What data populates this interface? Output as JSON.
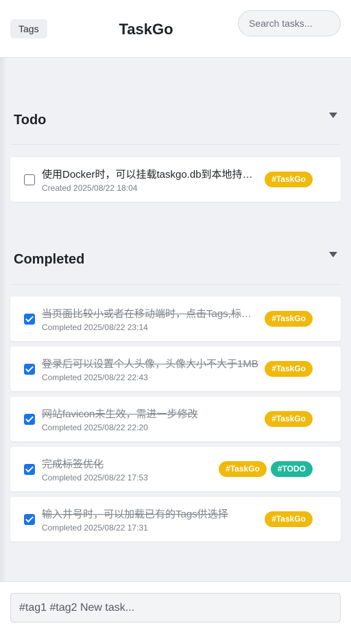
{
  "header": {
    "tags_label": "Tags",
    "title": "TaskGo",
    "search_placeholder": "Search tasks..."
  },
  "sections": {
    "todo": {
      "title": "Todo"
    },
    "completed": {
      "title": "Completed"
    }
  },
  "todo_tasks": [
    {
      "text": "使用Docker时，可以挂载taskgo.db到本地持久化数据",
      "meta": "Created 2025/08/22 18:04",
      "checked": false,
      "tags": [
        {
          "label": "#TaskGo",
          "color": "#f0b90b"
        }
      ]
    }
  ],
  "completed_tasks": [
    {
      "text": "当页面比较小或者在移动端时，点击Tags,标签栏显示",
      "meta": "Completed 2025/08/22 23:14",
      "checked": true,
      "tags": [
        {
          "label": "#TaskGo",
          "color": "#f0b90b"
        }
      ]
    },
    {
      "text": "登录后可以设置个人头像，头像大小不大于1MB",
      "meta": "Completed 2025/08/22 22:43",
      "checked": true,
      "tags": [
        {
          "label": "#TaskGo",
          "color": "#f0b90b"
        }
      ]
    },
    {
      "text": "网站favicon未生效，需进一步修改",
      "meta": "Completed 2025/08/22 22:20",
      "checked": true,
      "tags": [
        {
          "label": "#TaskGo",
          "color": "#f0b90b"
        }
      ]
    },
    {
      "text": "完成标签优化",
      "meta": "Completed 2025/08/22 17:53",
      "checked": true,
      "tags": [
        {
          "label": "#TaskGo",
          "color": "#f0b90b"
        },
        {
          "label": "#TODO",
          "color": "#1fb99a"
        }
      ]
    },
    {
      "text": "输入井号时，可以加载已有的Tags供选择",
      "meta": "Completed 2025/08/22 17:31",
      "checked": true,
      "tags": [
        {
          "label": "#TaskGo",
          "color": "#f0b90b"
        }
      ]
    }
  ],
  "new_task": {
    "placeholder": "#tag1 #tag2 New task..."
  }
}
